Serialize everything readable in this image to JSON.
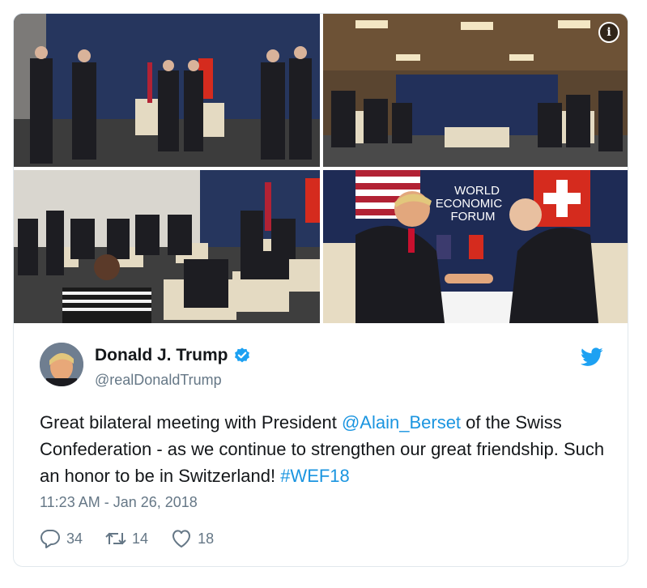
{
  "media": {
    "photos": [
      {
        "name": "meeting-photo-1"
      },
      {
        "name": "meeting-photo-2"
      },
      {
        "name": "meeting-photo-3"
      },
      {
        "name": "meeting-photo-4",
        "backdrop_text": [
          "WORLD",
          "ECONOMIC",
          "FORUM"
        ]
      }
    ],
    "info_icon": "i",
    "colors": {
      "backdrop": "#1c2950",
      "chair": "#e7dcc3",
      "carpet": "#3a3a3a"
    }
  },
  "tweet": {
    "author_name": "Donald J. Trump",
    "handle": "@realDonaldTrump",
    "text_parts": {
      "before_mention": "Great bilateral meeting with President ",
      "mention": "@Alain_Berset",
      "after_mention": " of the Swiss Confederation - as we continue to strengthen our great friendship. Such an honor to be in Switzerland! ",
      "hashtag": "#WEF18"
    },
    "timestamp": "11:23 AM - Jan 26, 2018",
    "stats": {
      "replies": "34",
      "retweets": "14",
      "likes": "18"
    },
    "icons": {
      "verified": "verified-badge-icon",
      "brand": "twitter-bird-icon",
      "reply": "reply-icon",
      "retweet": "retweet-icon",
      "like": "heart-icon"
    },
    "colors": {
      "link": "#1b95e0",
      "secondary": "#657786",
      "primary": "#14171a"
    }
  }
}
